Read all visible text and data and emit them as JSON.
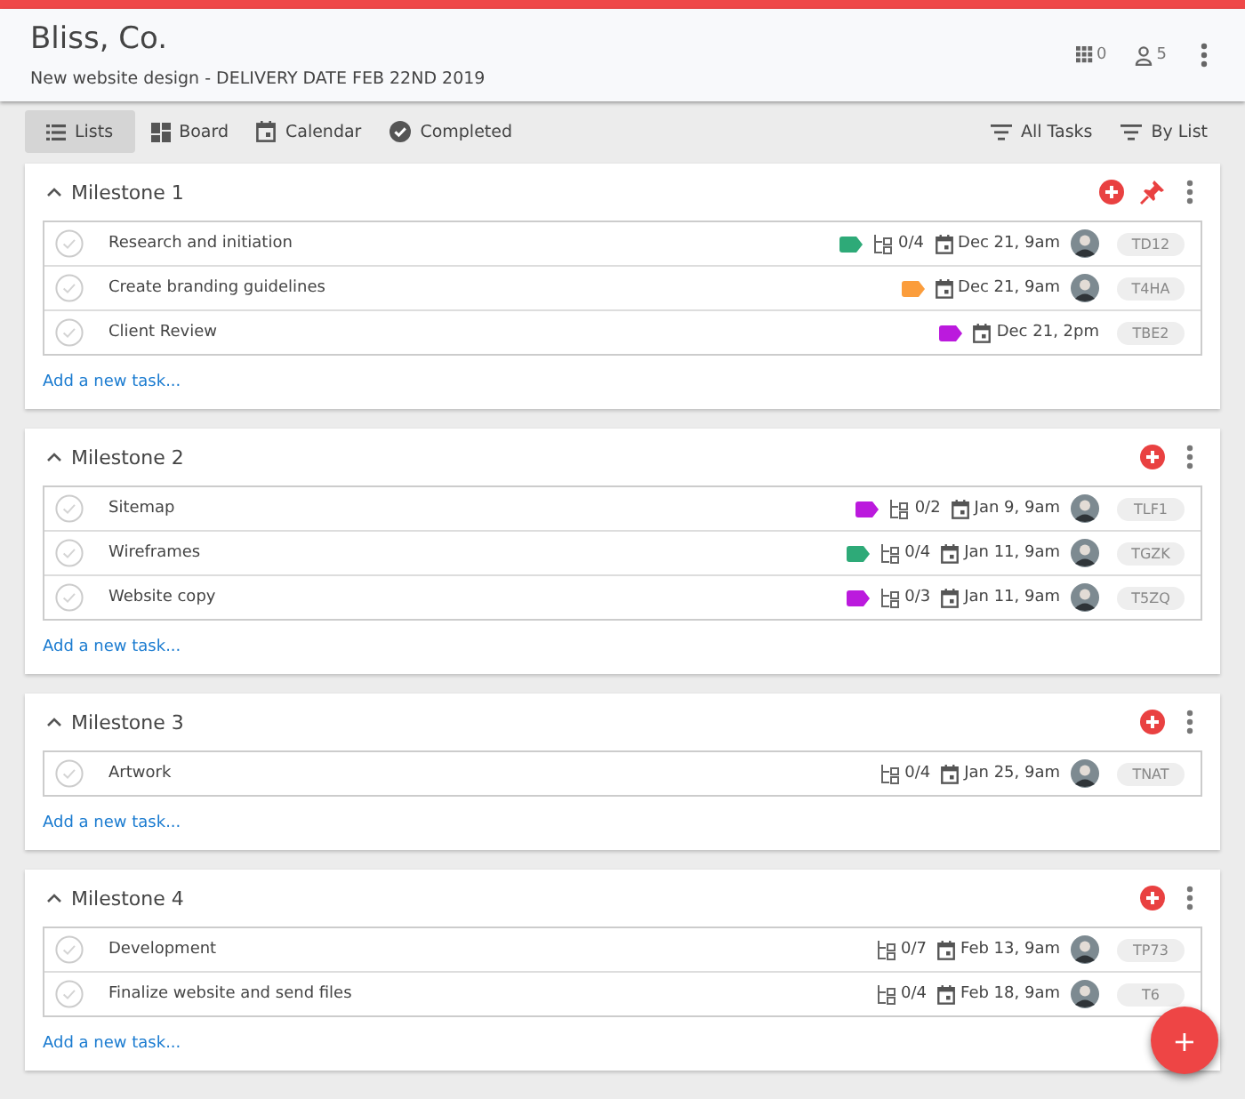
{
  "header": {
    "title": "Bliss, Co.",
    "subtitle": "New website design - DELIVERY DATE FEB 22ND 2019",
    "grid_count": "0",
    "member_count": "5"
  },
  "views": [
    {
      "label": "Lists",
      "selected": true
    },
    {
      "label": "Board",
      "selected": false
    },
    {
      "label": "Calendar",
      "selected": false
    },
    {
      "label": "Completed",
      "selected": false
    }
  ],
  "filters": [
    {
      "label": "All Tasks"
    },
    {
      "label": "By List"
    }
  ],
  "milestones": [
    {
      "title": "Milestone 1",
      "pinned": true,
      "add_label": "Add a new task...",
      "tasks": [
        {
          "name": "Research and initiation",
          "completed": false,
          "color": "#2eaa78",
          "subtasks": "0/4",
          "due": "Dec 21, 9am",
          "assigned": true,
          "code": "TD12"
        },
        {
          "name": "Create branding guidelines",
          "completed": false,
          "color": "#fb9d3c",
          "due": "Dec 21, 9am",
          "assigned": true,
          "code": "T4HA"
        },
        {
          "name": "Client Review",
          "completed": false,
          "color": "#bb1add",
          "due": "Dec 21, 2pm",
          "assigned": false,
          "code": "TBE2"
        }
      ]
    },
    {
      "title": "Milestone 2",
      "pinned": false,
      "add_label": "Add a new task...",
      "tasks": [
        {
          "name": "Sitemap",
          "completed": false,
          "color": "#bb1add",
          "subtasks": "0/2",
          "due": "Jan 9, 9am",
          "assigned": true,
          "code": "TLF1"
        },
        {
          "name": "Wireframes",
          "completed": false,
          "color": "#2eaa78",
          "subtasks": "0/4",
          "due": "Jan 11, 9am",
          "assigned": true,
          "code": "TGZK"
        },
        {
          "name": "Website copy",
          "completed": false,
          "color": "#bb1add",
          "subtasks": "0/3",
          "due": "Jan 11, 9am",
          "assigned": true,
          "code": "T5ZQ"
        }
      ]
    },
    {
      "title": "Milestone 3",
      "pinned": false,
      "add_label": "Add a new task...",
      "tasks": [
        {
          "name": "Artwork",
          "completed": false,
          "subtasks": "0/4",
          "due": "Jan 25, 9am",
          "assigned": true,
          "code": "TNAT"
        }
      ]
    },
    {
      "title": "Milestone 4",
      "pinned": false,
      "add_label": "Add a new task...",
      "tasks": [
        {
          "name": "Development",
          "completed": false,
          "subtasks": "0/7",
          "due": "Feb 13, 9am",
          "assigned": true,
          "code": "TP73"
        },
        {
          "name": "Finalize website and send files",
          "completed": false,
          "subtasks": "0/4",
          "due": "Feb 18, 9am",
          "assigned": true,
          "code": "T6"
        }
      ]
    }
  ],
  "fab": {
    "label": "+"
  }
}
